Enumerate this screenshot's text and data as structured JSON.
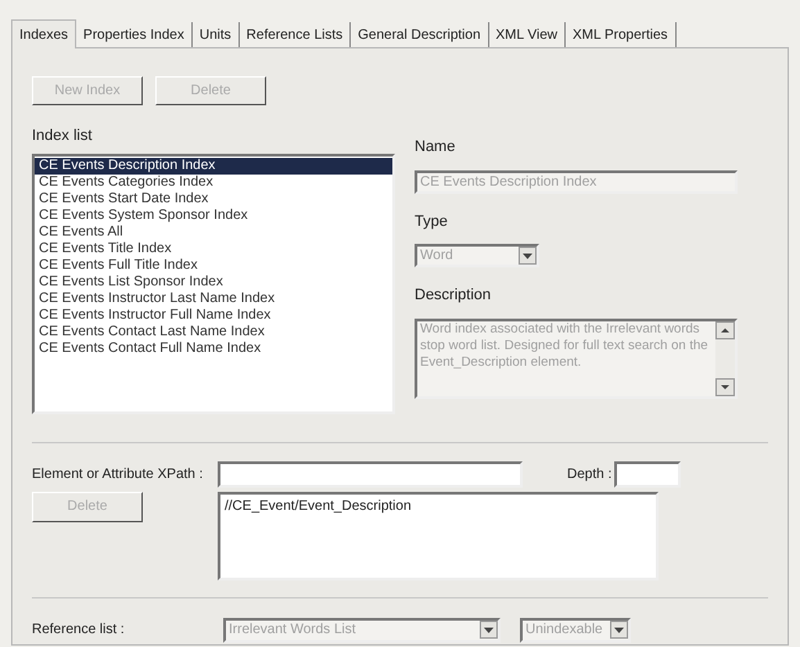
{
  "tabs": [
    {
      "label": "Indexes",
      "selected": true
    },
    {
      "label": "Properties Index",
      "selected": false
    },
    {
      "label": "Units",
      "selected": false
    },
    {
      "label": "Reference Lists",
      "selected": false
    },
    {
      "label": "General Description",
      "selected": false
    },
    {
      "label": "XML View",
      "selected": false
    },
    {
      "label": "XML Properties",
      "selected": false
    }
  ],
  "toolbar": [
    {
      "label": "New Index",
      "disabled": true
    },
    {
      "label": "Delete",
      "disabled": true
    }
  ],
  "index_list": {
    "label": "Index list",
    "items": [
      {
        "label": "CE Events Description Index",
        "selected": true
      },
      {
        "label": "CE Events Categories Index",
        "selected": false
      },
      {
        "label": "CE Events Start Date Index",
        "selected": false
      },
      {
        "label": "CE Events System Sponsor Index",
        "selected": false
      },
      {
        "label": "CE Events All",
        "selected": false
      },
      {
        "label": "CE Events Title Index",
        "selected": false
      },
      {
        "label": "CE Events Full Title Index",
        "selected": false
      },
      {
        "label": "CE Events List Sponsor Index",
        "selected": false
      },
      {
        "label": "CE Events Instructor Last Name Index",
        "selected": false
      },
      {
        "label": "CE Events Instructor Full Name Index",
        "selected": false
      },
      {
        "label": "CE Events Contact Last Name Index",
        "selected": false
      },
      {
        "label": "CE Events Contact Full Name Index",
        "selected": false
      }
    ]
  },
  "name": {
    "label": "Name",
    "value": "CE Events Description Index",
    "disabled": true
  },
  "type": {
    "label": "Type",
    "value": "Word",
    "disabled": true
  },
  "description": {
    "label": "Description",
    "value": "Word index associated with the Irrelevant words stop word list. Designed for full text search on the Event_Description element.",
    "disabled": true
  },
  "xpath": {
    "label": "Element or Attribute XPath :",
    "depth_label": "Depth :",
    "delete_button": {
      "label": "Delete",
      "disabled": true
    },
    "paths": [
      "//CE_Event/Event_Description"
    ]
  },
  "reference": {
    "label": "Reference list :",
    "list_value": "Irrelevant Words List",
    "mode_value": "Unindexable",
    "disabled": true
  }
}
